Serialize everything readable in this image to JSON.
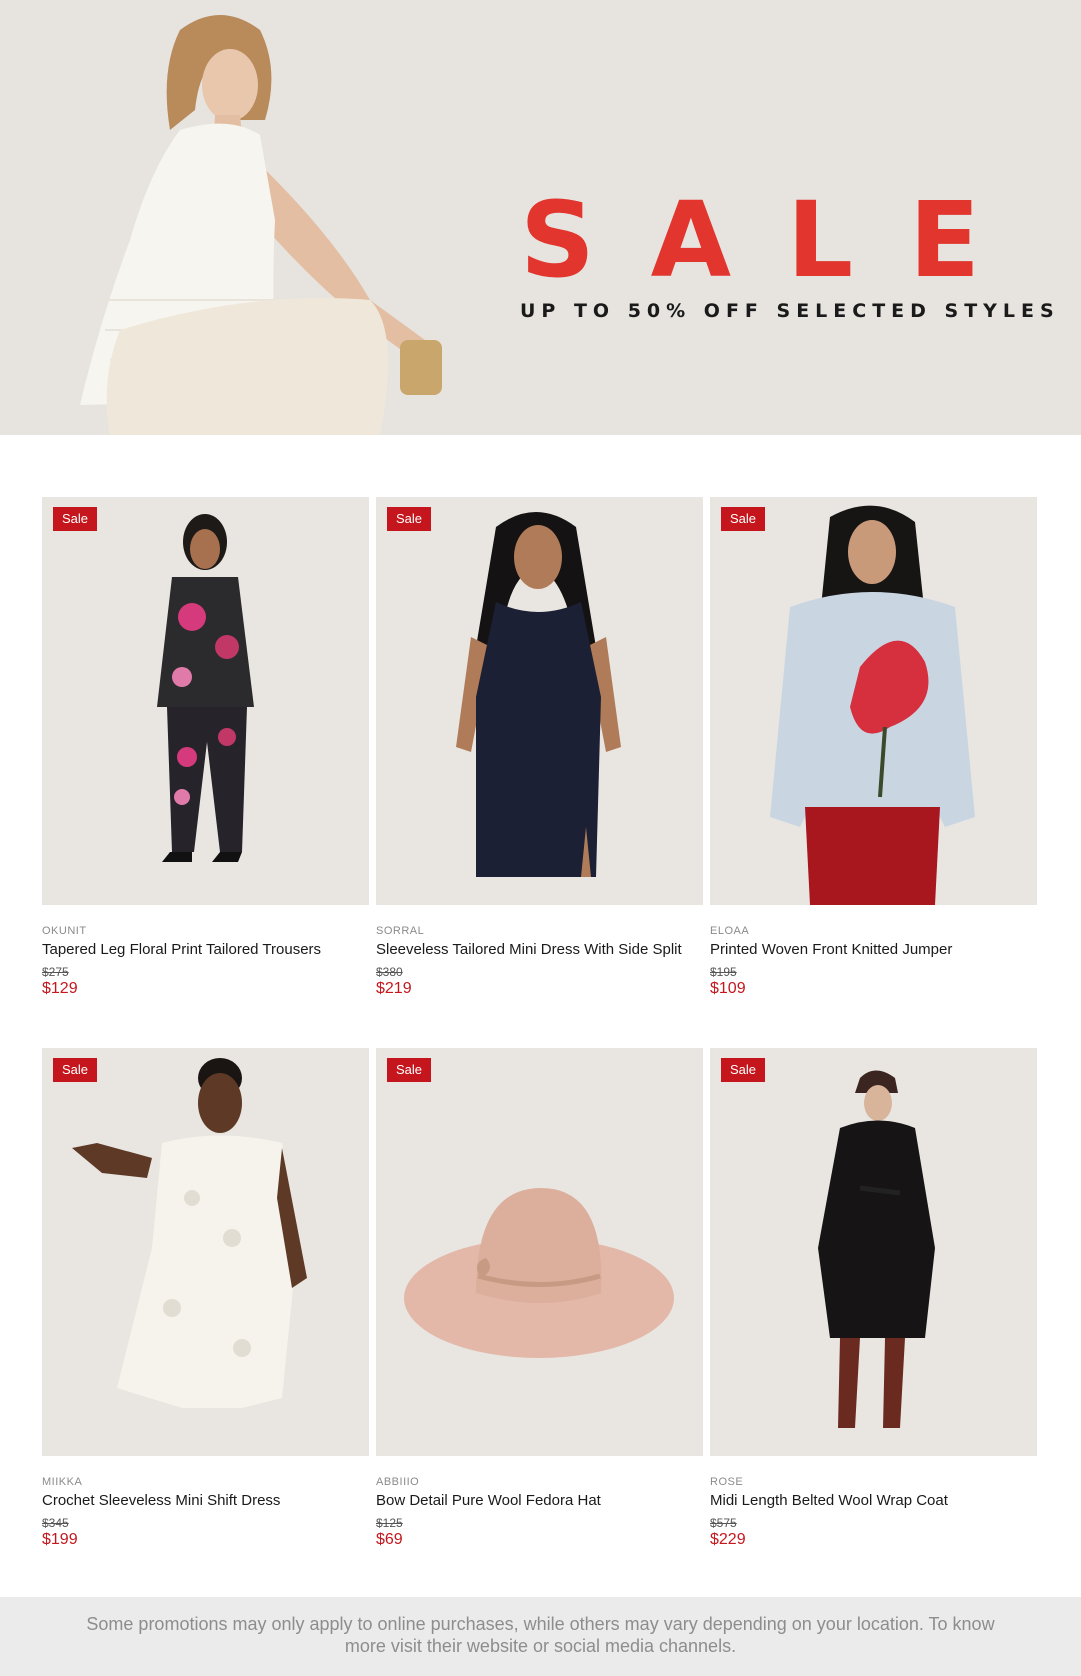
{
  "hero": {
    "letters": [
      "S",
      "A",
      "L",
      "E"
    ],
    "subtitle": "UP TO 50% OFF SELECTED STYLES",
    "accent_color": "#e1352e"
  },
  "products": [
    {
      "badge": "Sale",
      "brand": "OKUNIT",
      "name": "Tapered Leg Floral Print Tailored Trousers",
      "was": "$275",
      "now": "$129",
      "image": "woman-floral-suit"
    },
    {
      "badge": "Sale",
      "brand": "SORRAL",
      "name": "Sleeveless Tailored Mini Dress With Side Split",
      "was": "$380",
      "now": "$219",
      "image": "woman-navy-dress"
    },
    {
      "badge": "Sale",
      "brand": "ELOAA",
      "name": "Printed Woven Front Knitted Jumper",
      "was": "$195",
      "now": "$109",
      "image": "woman-flower-jumper"
    },
    {
      "badge": "Sale",
      "brand": "MIIKKA",
      "name": "Crochet Sleeveless Mini Shift Dress",
      "was": "$345",
      "now": "$199",
      "image": "woman-white-crochet-dress"
    },
    {
      "badge": "Sale",
      "brand": "ABBIIIO",
      "name": "Bow Detail Pure Wool Fedora Hat",
      "was": "$125",
      "now": "$69",
      "image": "pink-fedora-hat"
    },
    {
      "badge": "Sale",
      "brand": "ROSE",
      "name": "Midi Length Belted Wool Wrap Coat",
      "was": "$575",
      "now": "$229",
      "image": "woman-black-coat"
    }
  ],
  "footer": {
    "text": "Some promotions may only apply to online purchases, while others may vary depending on your location. To know more visit their website or social media channels."
  },
  "colors": {
    "sale_badge": "#c4161c",
    "price": "#c4161c",
    "hero_bg": "#e7e4e0",
    "card_bg": "#e9e6e2"
  }
}
